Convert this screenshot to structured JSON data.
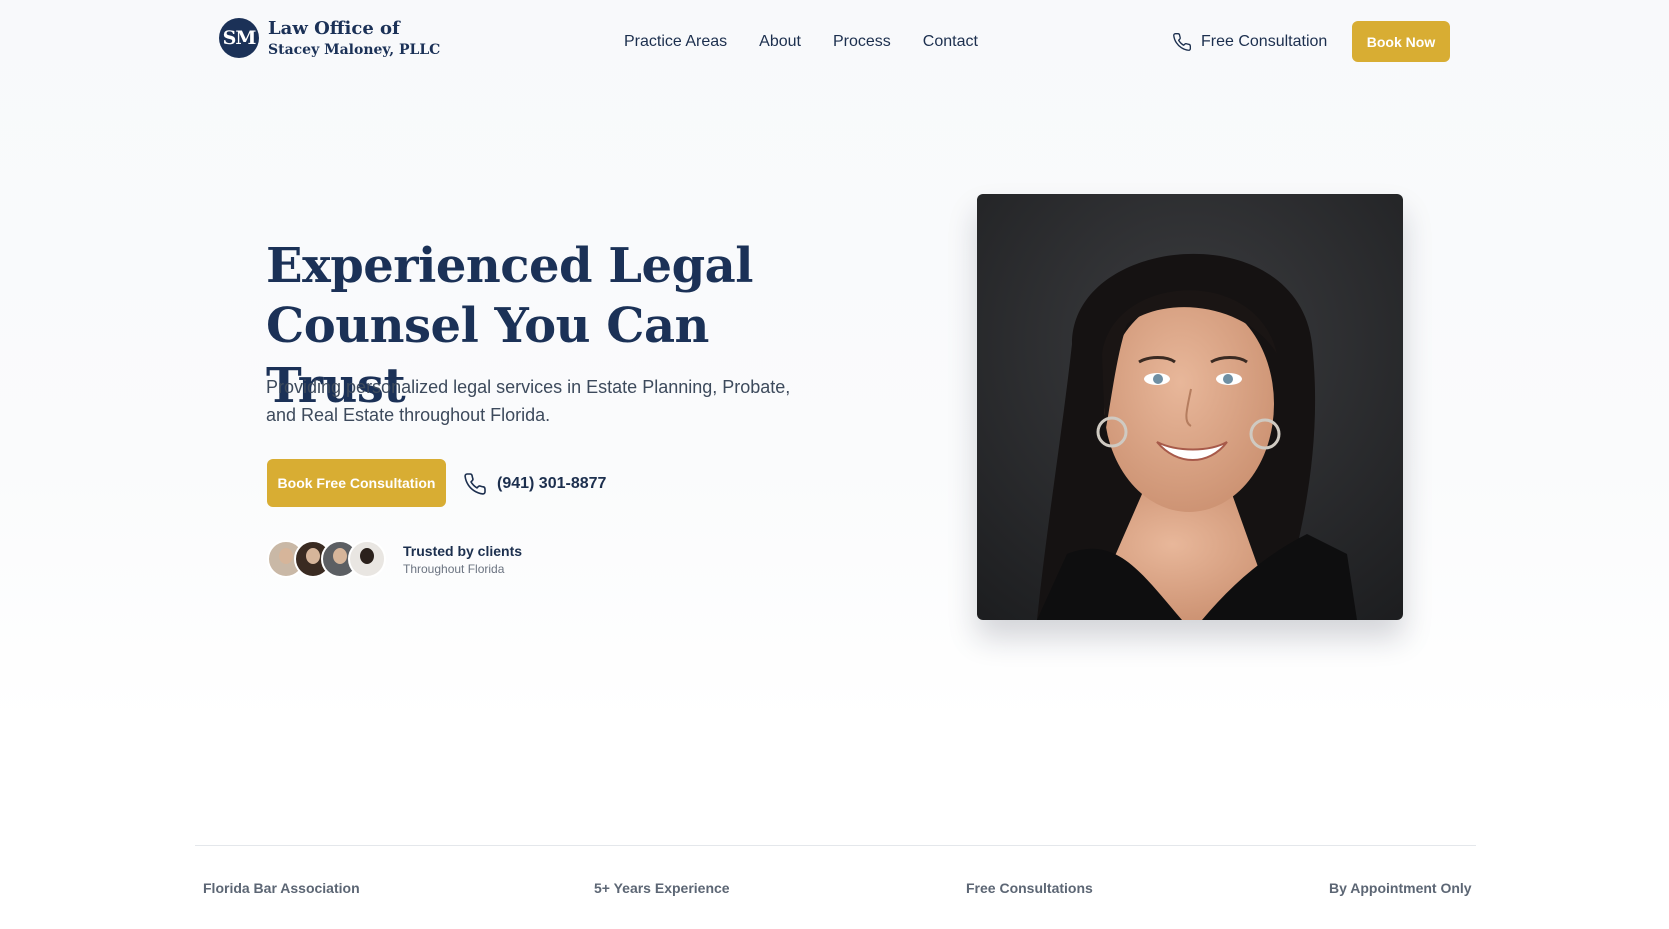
{
  "header": {
    "logo_initials": "SM",
    "logo_line1": "Law Office of",
    "logo_line2": "Stacey Maloney, PLLC",
    "nav": [
      "Practice Areas",
      "About",
      "Process",
      "Contact"
    ],
    "phone_label": "Free Consultation",
    "book_now_label": "Book Now"
  },
  "hero": {
    "title": "Experienced Legal Counsel You Can Trust",
    "subtitle": "Providing personalized legal services in Estate Planning, Probate, and Real Estate throughout Florida.",
    "cta_label": "Book Free Consultation",
    "phone": "(941) 301-8877",
    "trust_title": "Trusted by clients",
    "trust_subtitle": "Throughout Florida"
  },
  "stats": [
    "Florida Bar Association",
    "5+ Years Experience",
    "Free Consultations",
    "By Appointment Only"
  ],
  "colors": {
    "navy": "#1b3157",
    "gold": "#d8ad33"
  },
  "icons": {
    "phone": "phone-icon"
  }
}
